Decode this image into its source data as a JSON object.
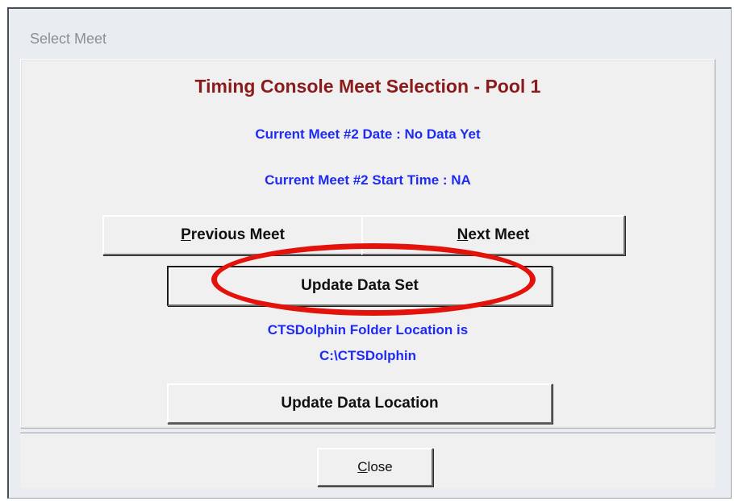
{
  "window": {
    "title": "Select Meet"
  },
  "panel": {
    "heading": "Timing Console Meet Selection - Pool 1",
    "meet_date": "Current Meet #2 Date : No Data Yet",
    "meet_start_time": "Current Meet #2 Start Time : NA",
    "folder_location_line1": "CTSDolphin Folder Location is",
    "folder_location_line2": "C:\\CTSDolphin"
  },
  "buttons": {
    "previous_meet": {
      "accel": "P",
      "rest": "revious Meet"
    },
    "next_meet": {
      "accel": "N",
      "rest": "ext Meet"
    },
    "update_data_set": "Update Data Set",
    "update_data_location": "Update Data Location",
    "close": {
      "accel": "C",
      "rest": "lose"
    }
  },
  "annotation": {
    "ring_color": "#e3120b",
    "ring_target": "update-data-set-button"
  }
}
